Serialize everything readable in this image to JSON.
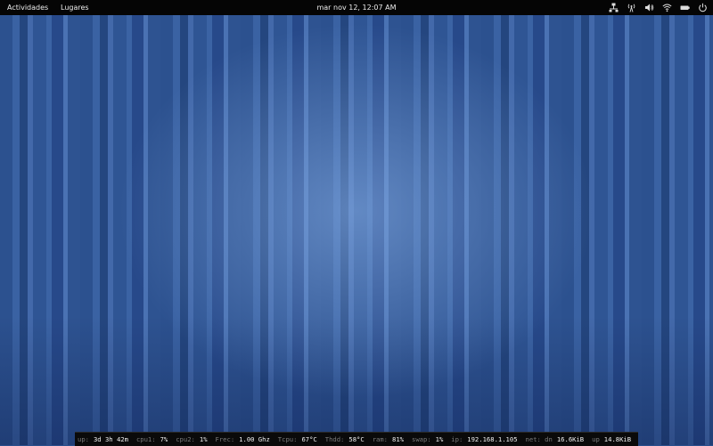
{
  "topbar": {
    "activities": "Actividades",
    "places": "Lugares",
    "clock": "mar nov 12, 12:07 AM"
  },
  "tray_icons": [
    "network-bridge-icon",
    "signal-antenna-icon",
    "volume-icon",
    "wifi-icon",
    "battery-icon",
    "power-icon"
  ],
  "conky": [
    {
      "label": "up:",
      "value": "3d 3h 42m"
    },
    {
      "label": "cpu1:",
      "value": "7%"
    },
    {
      "label": "cpu2:",
      "value": "1%"
    },
    {
      "label": "Frec:",
      "value": "1.00 Ghz"
    },
    {
      "label": "Tcpu:",
      "value": "67°C"
    },
    {
      "label": "Thdd:",
      "value": "58°C"
    },
    {
      "label": "ram:",
      "value": "81%"
    },
    {
      "label": "swap:",
      "value": "1%"
    },
    {
      "label": "ip:",
      "value": "192.168.1.105"
    },
    {
      "label": "net: dn",
      "value": "16.6KiB"
    },
    {
      "label": "up",
      "value": "14.8KiB"
    }
  ]
}
